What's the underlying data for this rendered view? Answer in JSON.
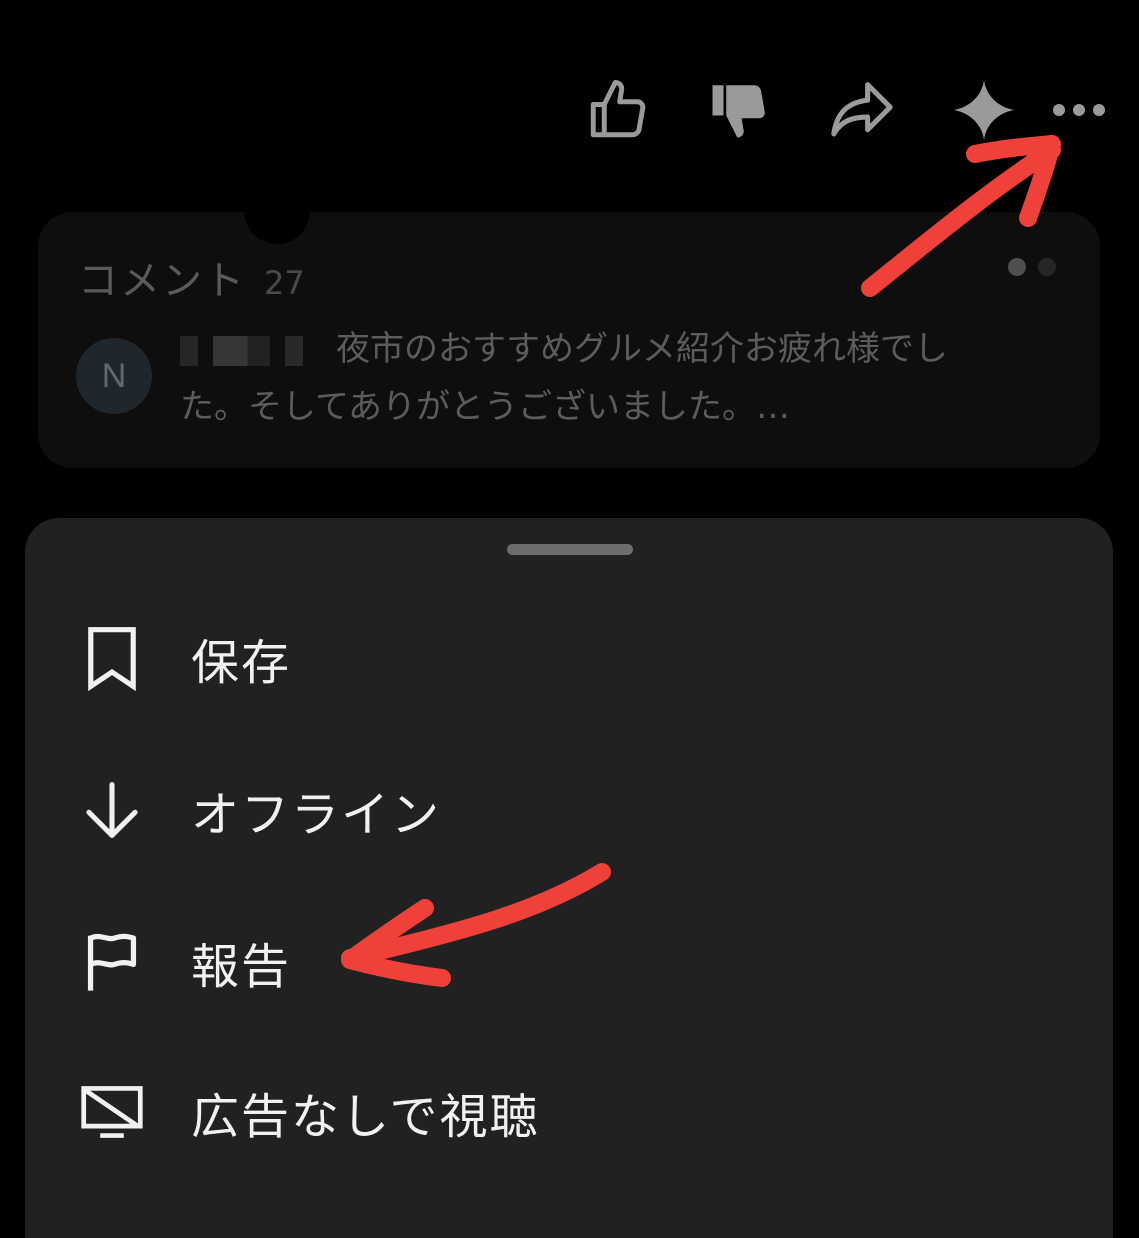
{
  "actions": {
    "like_icon": "thumbs-up-icon",
    "dislike_icon": "thumbs-down-icon",
    "share_icon": "share-icon",
    "ask_icon": "sparkle-icon",
    "more_icon": "more-horizontal-icon"
  },
  "comments": {
    "title": "コメント",
    "count": "27",
    "avatar_initial": "N",
    "preview_line1": "夜市のおすすめグルメ紹介お疲れ様でし",
    "preview_line2": "た。そしてありがとうございました。…"
  },
  "menu": {
    "items": [
      {
        "label": "保存",
        "icon": "bookmark-icon"
      },
      {
        "label": "オフライン",
        "icon": "download-icon"
      },
      {
        "label": "報告",
        "icon": "flag-icon"
      },
      {
        "label": "広告なしで視聴",
        "icon": "no-ads-icon"
      }
    ]
  },
  "colors": {
    "background": "#000000",
    "sheet": "#212121",
    "annotation": "#f0403a"
  }
}
